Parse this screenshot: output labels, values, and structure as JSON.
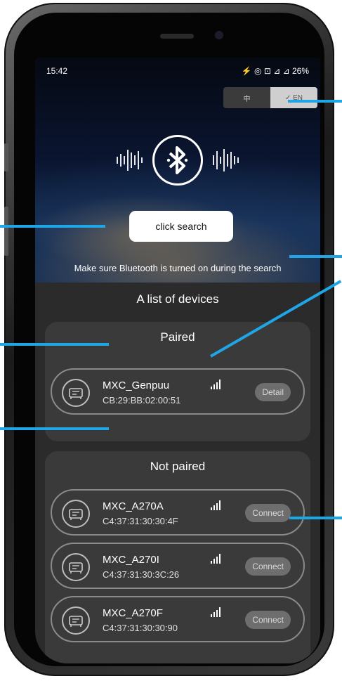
{
  "status_bar": {
    "time": "15:42",
    "icons_text": "⚡ ◎ ⊡ ⊿ ⊿ 26%",
    "battery": "26%"
  },
  "language_toggle": {
    "options": [
      "中",
      "✓ EN"
    ],
    "selected": "EN"
  },
  "hero": {
    "search_button": "click search",
    "hint": "Make sure Bluetooth is turned on during the search"
  },
  "device_list": {
    "title": "A list of devices",
    "paired": {
      "title": "Paired",
      "devices": [
        {
          "name": "MXC_Genpuu",
          "mac": "CB:29:BB:02:00:51",
          "action": "Detail"
        }
      ]
    },
    "not_paired": {
      "title": "Not paired",
      "devices": [
        {
          "name": "MXC_A270A",
          "mac": "C4:37:31:30:30:4F",
          "action": "Connect"
        },
        {
          "name": "MXC_A270I",
          "mac": "C4:37:31:30:3C:26",
          "action": "Connect"
        },
        {
          "name": "MXC_A270F",
          "mac": "C4:37:31:30:30:90",
          "action": "Connect"
        }
      ]
    }
  },
  "colors": {
    "callout": "#1ea6e6",
    "screen_bg": "#2b2b2b",
    "card_bg": "#3a3a3a"
  },
  "icons": [
    "bluetooth-icon",
    "sound-wave-icon",
    "generator-icon",
    "signal-strength-icon"
  ]
}
